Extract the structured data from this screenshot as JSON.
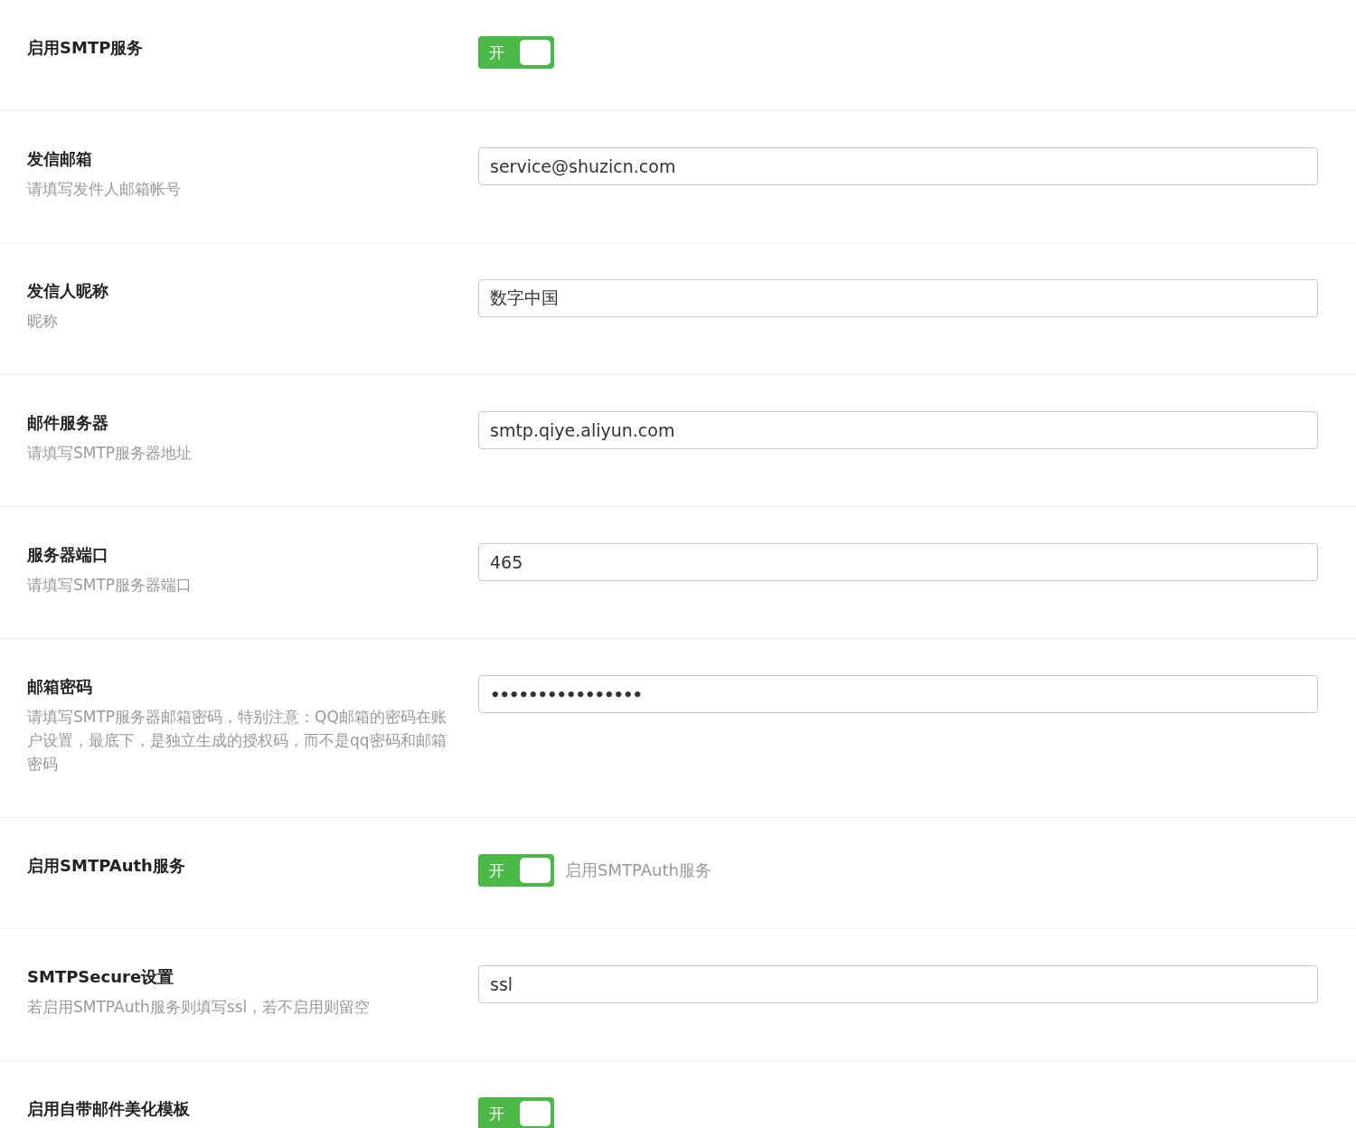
{
  "settings": [
    {
      "kind": "switch",
      "title": "启用SMTP服务",
      "switch": {
        "on": true,
        "label": "开"
      }
    },
    {
      "kind": "text",
      "title": "发信邮箱",
      "hint": "请填写发件人邮箱帐号",
      "value": "service@shuzicn.com"
    },
    {
      "kind": "text",
      "title": "发信人昵称",
      "hint": "昵称",
      "value": "数字中国"
    },
    {
      "kind": "text",
      "title": "邮件服务器",
      "hint": "请填写SMTP服务器地址",
      "value": "smtp.qiye.aliyun.com"
    },
    {
      "kind": "text",
      "title": "服务器端口",
      "hint": "请填写SMTP服务器端口",
      "value": "465"
    },
    {
      "kind": "password",
      "title": "邮箱密码",
      "hint": "请填写SMTP服务器邮箱密码，特别注意：QQ邮箱的密码在账户设置，最底下，是独立生成的授权码，而不是qq密码和邮箱密码",
      "value": "••••••••••••••••"
    },
    {
      "kind": "switch",
      "title": "启用SMTPAuth服务",
      "switch": {
        "on": true,
        "label": "开"
      },
      "note": "启用SMTPAuth服务"
    },
    {
      "kind": "text",
      "title": "SMTPSecure设置",
      "hint": "若启用SMTPAuth服务则填写ssl，若不启用则留空",
      "value": "ssl"
    },
    {
      "kind": "switch",
      "title": "启用自带邮件美化模板",
      "switch": {
        "on": true,
        "label": "开"
      }
    }
  ]
}
